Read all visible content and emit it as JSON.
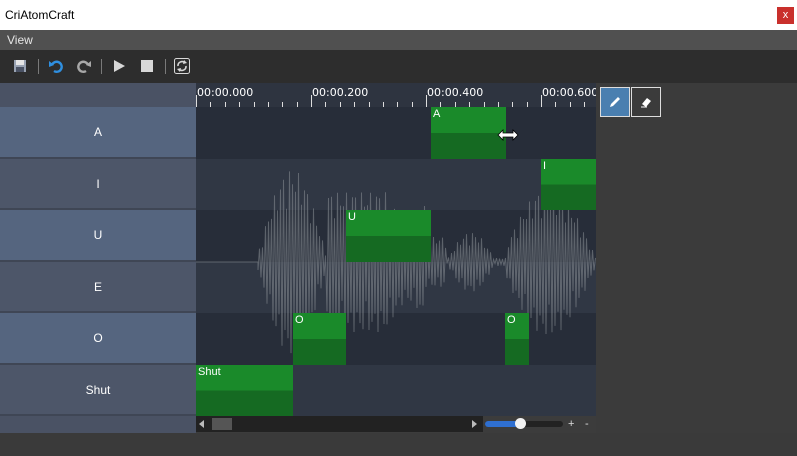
{
  "app": {
    "title": "CriAtomCraft",
    "close_label": "x"
  },
  "menu": {
    "view": "View"
  },
  "toolbar": {
    "icons": [
      "save-icon",
      "undo-icon",
      "redo-icon",
      "play-icon",
      "stop-icon",
      "refresh-icon"
    ]
  },
  "timeline": {
    "ruler_labels": [
      "00:00.000",
      "00:00.200",
      "00:00.400",
      "00:00.600"
    ],
    "tracks": [
      {
        "label": "A"
      },
      {
        "label": "I"
      },
      {
        "label": "U"
      },
      {
        "label": "E"
      },
      {
        "label": "O"
      },
      {
        "label": "Shut"
      }
    ],
    "segments": [
      {
        "track": "A",
        "label": "A",
        "start": 0.408,
        "end": 0.538
      },
      {
        "track": "I",
        "label": "I",
        "start": 0.6,
        "end": 0.697
      },
      {
        "track": "U",
        "label": "U",
        "start": 0.26,
        "end": 0.408
      },
      {
        "track": "O",
        "label": "O",
        "start": 0.168,
        "end": 0.26
      },
      {
        "track": "O",
        "label": "O",
        "start": 0.538,
        "end": 0.579
      },
      {
        "track": "Shut",
        "label": "Shut",
        "start": 0.0,
        "end": 0.168
      }
    ]
  },
  "tools": {
    "pencil": "pencil-icon",
    "eraser": "eraser-icon"
  },
  "zoom": {
    "plus": "+",
    "minus": "-",
    "level": 0.45
  },
  "colors": {
    "segment": "#1a8a2a",
    "track_dark": "#272d39",
    "track_light": "#303744",
    "selected_tool": "#4a7fb0"
  }
}
